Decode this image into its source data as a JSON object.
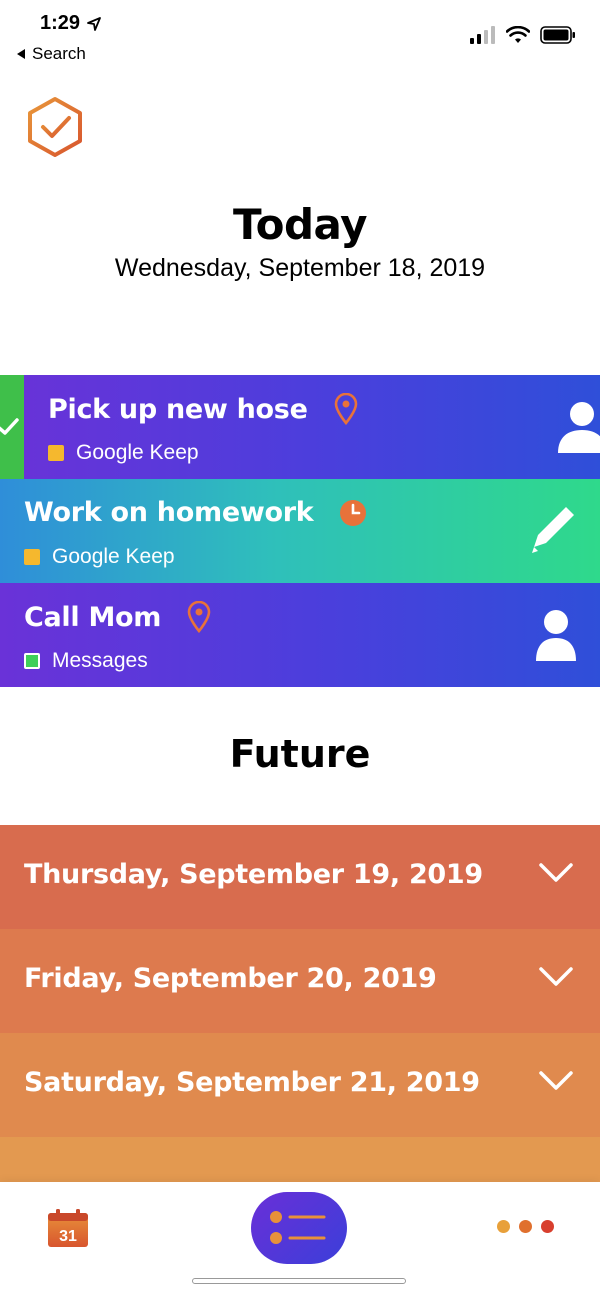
{
  "status_bar": {
    "time": "1:29",
    "back_label": "Search"
  },
  "header": {
    "logo_icon": "hexagon-check-icon",
    "menu_icon": "menu-lines-icon"
  },
  "today": {
    "title": "Today",
    "date": "Wednesday, September 18, 2019"
  },
  "tasks": [
    {
      "title": "Pick up new hose",
      "source": "Google Keep",
      "indicator_icon": "location-pin-icon",
      "action_icon": "person-icon",
      "completed_strip": true
    },
    {
      "title": "Work on homework",
      "source": "Google Keep",
      "indicator_icon": "clock-icon",
      "action_icon": "pencil-icon"
    },
    {
      "title": "Call Mom",
      "source": "Messages",
      "indicator_icon": "location-pin-icon",
      "action_icon": "person-icon"
    }
  ],
  "future": {
    "title": "Future",
    "days": [
      "Thursday, September 19, 2019",
      "Friday, September 20, 2019",
      "Saturday, September 21, 2019"
    ]
  },
  "tab_bar": {
    "calendar_day": "31",
    "colors": {
      "orange": "#e0702e",
      "purple": "#5a35d9",
      "red": "#d83f2e",
      "green": "#3fbf4a"
    }
  }
}
